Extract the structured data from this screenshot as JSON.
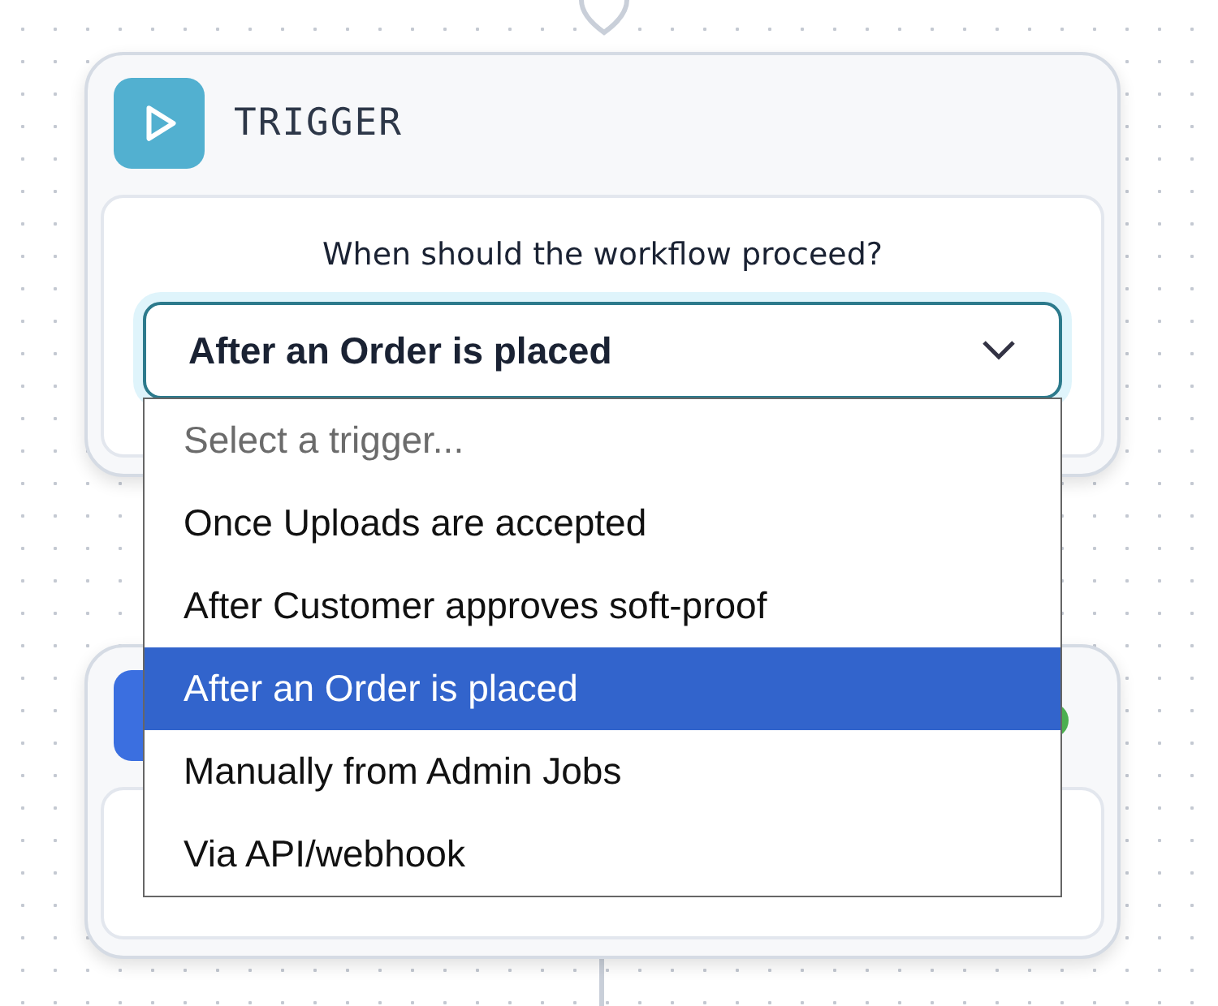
{
  "trigger_node": {
    "title": "TRIGGER",
    "question": "When should the workflow proceed?",
    "select": {
      "value": "After an Order is placed",
      "expanded": true,
      "options": [
        {
          "label": "Select a trigger...",
          "kind": "placeholder",
          "selected": false
        },
        {
          "label": "Once Uploads are accepted",
          "kind": "option",
          "selected": false
        },
        {
          "label": "After Customer approves soft-proof",
          "kind": "option",
          "selected": false
        },
        {
          "label": "After an Order is placed",
          "kind": "option",
          "selected": true
        },
        {
          "label": "Manually from Admin Jobs",
          "kind": "option",
          "selected": false
        },
        {
          "label": "Via API/webhook",
          "kind": "option",
          "selected": false
        }
      ]
    }
  }
}
